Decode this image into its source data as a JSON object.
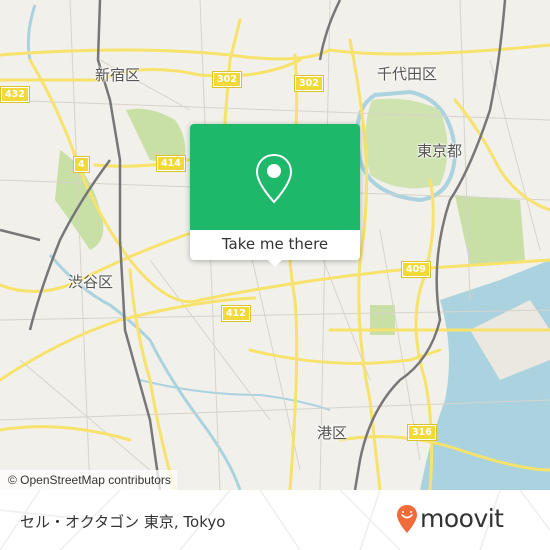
{
  "map": {
    "place_labels": [
      {
        "id": "shinjuku",
        "text": "新宿区"
      },
      {
        "id": "chiyoda",
        "text": "千代田区"
      },
      {
        "id": "tokyo-to",
        "text": "東京都"
      },
      {
        "id": "shibuya",
        "text": "渋谷区"
      },
      {
        "id": "minato",
        "text": "港区"
      }
    ],
    "route_shields": [
      "432",
      "302",
      "302",
      "4",
      "414",
      "412",
      "409",
      "316"
    ],
    "attribution": "© OpenStreetMap contributors",
    "colors": {
      "land": "#f2f0ea",
      "water": "#aad3df",
      "park": "#c8dfa5",
      "major_road": "#f7e26b",
      "rail": "#777777",
      "shield": "#f1d93a"
    }
  },
  "popup": {
    "icon": "location-pin-icon",
    "button_label": "Take me there",
    "color": "#1db86a"
  },
  "footer": {
    "location_title": "セル・オクタゴン 東京, Tokyo",
    "brand": "moovit",
    "brand_color": "#f26b3a"
  }
}
